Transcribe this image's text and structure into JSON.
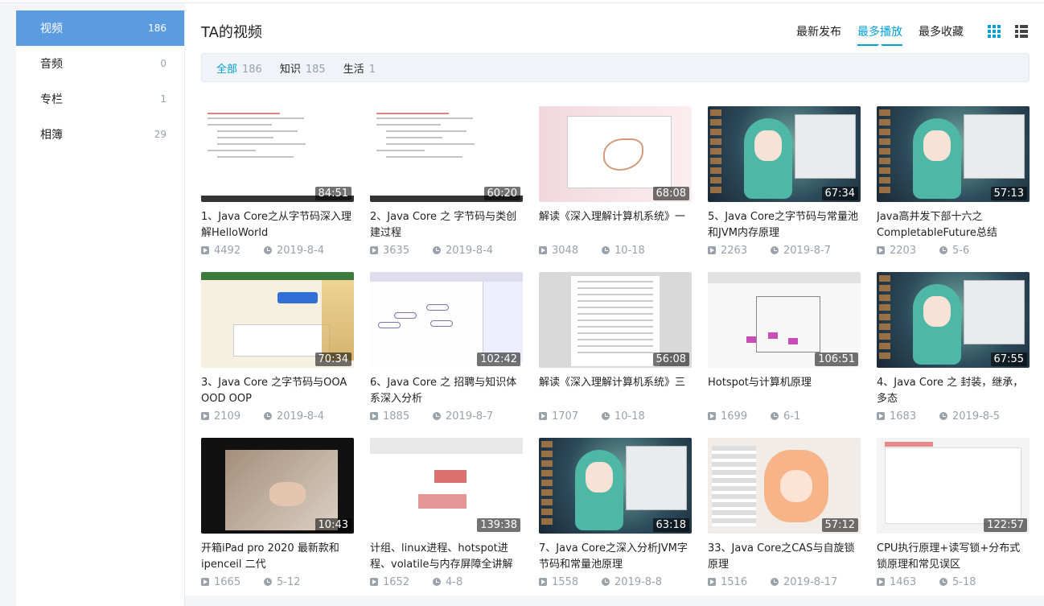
{
  "sidebar": {
    "items": [
      {
        "label": "视频",
        "count": "186"
      },
      {
        "label": "音频",
        "count": "0"
      },
      {
        "label": "专栏",
        "count": "1"
      },
      {
        "label": "相簿",
        "count": "29"
      }
    ]
  },
  "main": {
    "title": "TA的视频",
    "order": [
      "最新发布",
      "最多播放",
      "最多收藏"
    ],
    "filters": [
      {
        "label": "全部",
        "count": "186"
      },
      {
        "label": "知识",
        "count": "185"
      },
      {
        "label": "生活",
        "count": "1"
      }
    ]
  },
  "videos": [
    {
      "title": "1、Java Core之从字节码深入理解HelloWorld",
      "duration": "84:51",
      "plays": "4492",
      "date": "2019-8-4",
      "thumb": "code"
    },
    {
      "title": "2、Java Core 之 字节码与类创建过程",
      "duration": "60:20",
      "plays": "3635",
      "date": "2019-8-4",
      "thumb": "code"
    },
    {
      "title": "解读《深入理解计算机系统》一",
      "duration": "68:08",
      "plays": "3048",
      "date": "10-18",
      "thumb": "pink"
    },
    {
      "title": "5、Java Core之字节码与常量池和JVM内存原理",
      "duration": "67:34",
      "plays": "2263",
      "date": "2019-8-7",
      "thumb": "anime"
    },
    {
      "title": "Java高并发下部十六之CompletableFuture总结",
      "duration": "57:13",
      "plays": "2203",
      "date": "5-6",
      "thumb": "anime"
    },
    {
      "title": "3、Java Core 之字节码与OOA OOD OOP",
      "duration": "70:34",
      "plays": "2109",
      "date": "2019-8-4",
      "thumb": "web"
    },
    {
      "title": "6、Java Core 之 招聘与知识体系深入分析",
      "duration": "102:42",
      "plays": "1885",
      "date": "2019-8-7",
      "thumb": "mind"
    },
    {
      "title": "解读《深入理解计算机系统》三",
      "duration": "56:08",
      "plays": "1707",
      "date": "10-18",
      "thumb": "doc"
    },
    {
      "title": "Hotspot与计算机原理",
      "duration": "106:51",
      "plays": "1699",
      "date": "6-1",
      "thumb": "mac"
    },
    {
      "title": "4、Java Core 之 封装，继承，多态",
      "duration": "67:55",
      "plays": "1683",
      "date": "2019-8-5",
      "thumb": "anime"
    },
    {
      "title": "开箱iPad pro 2020 最新款和ipenceil 二代",
      "duration": "10:43",
      "plays": "1665",
      "date": "5-12",
      "thumb": "ipad"
    },
    {
      "title": "计组、linux进程、hotspot进程、volatile与内存屏障全讲解",
      "duration": "139:38",
      "plays": "1652",
      "date": "4-8",
      "thumb": "chart"
    },
    {
      "title": "7、Java Core之深入分析JVM字节码和常量池原理",
      "duration": "63:18",
      "plays": "1558",
      "date": "2019-8-8",
      "thumb": "anime"
    },
    {
      "title": "33、Java Core之CAS与自旋锁原理",
      "duration": "57:12",
      "plays": "1516",
      "date": "2019-8-17",
      "thumb": "girl"
    },
    {
      "title": "CPU执行原理+读写锁+分布式锁原理和常见误区",
      "duration": "122:57",
      "plays": "1463",
      "date": "5-18",
      "thumb": "blank"
    }
  ],
  "colors": {
    "accent": "#00a1d6",
    "sidebar_active": "#5b9be0",
    "muted": "#99a2aa"
  },
  "icons": {
    "plays": "play-count-icon",
    "date": "clock-icon",
    "grid_view": "grid-view-icon",
    "list_view": "list-view-icon"
  }
}
